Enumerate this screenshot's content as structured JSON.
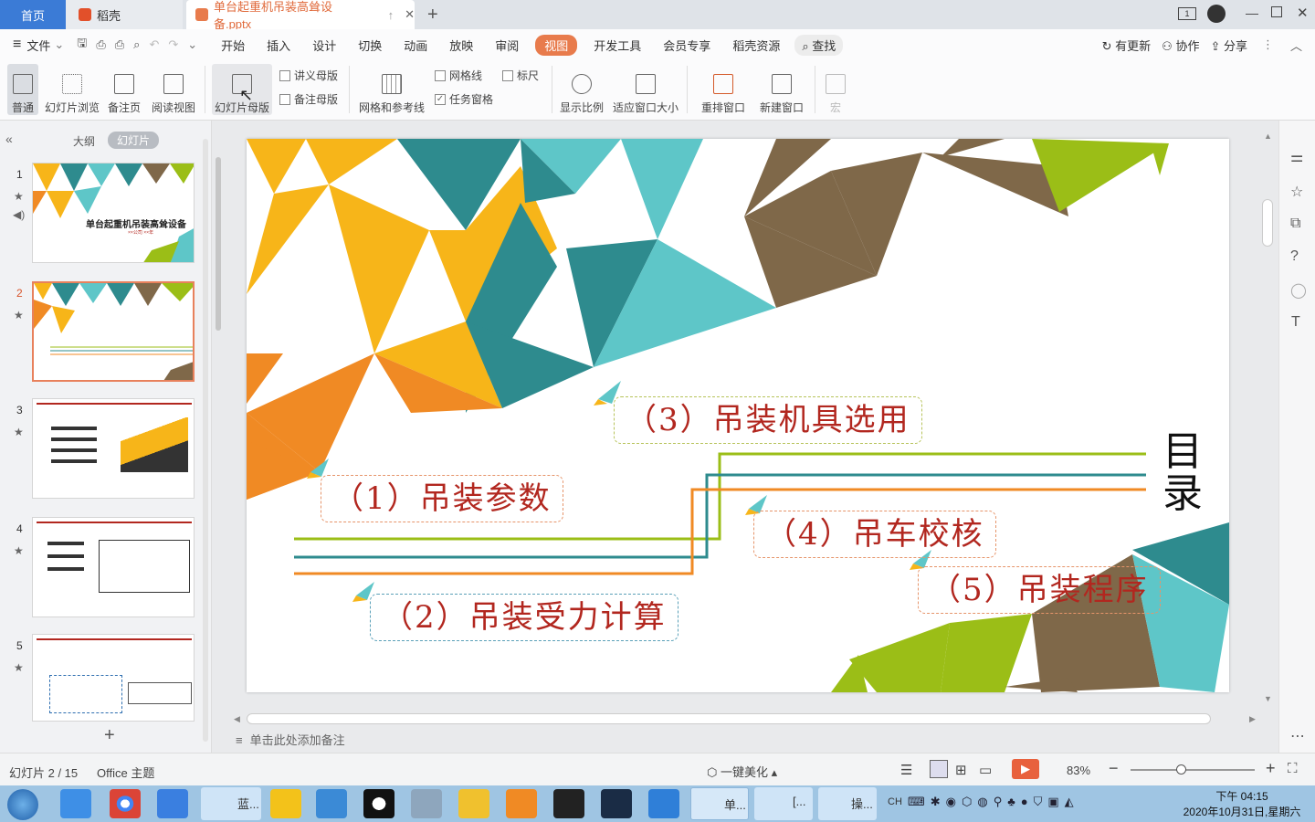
{
  "tabs": {
    "home": "首页",
    "daoke": "稻壳",
    "doc": "单台起重机吊装高耸设备.pptx"
  },
  "menu": {
    "file": "文件",
    "items": [
      "开始",
      "插入",
      "设计",
      "切换",
      "动画",
      "放映",
      "审阅",
      "视图",
      "开发工具",
      "会员专享",
      "稻壳资源"
    ],
    "search": "查找",
    "update": "有更新",
    "collab": "协作",
    "share": "分享"
  },
  "ribbon": {
    "normal": "普通",
    "slide_browse": "幻灯片浏览",
    "notes_page": "备注页",
    "reading_view": "阅读视图",
    "slide_master": "幻灯片母版",
    "handout_master": "讲义母版",
    "notes_master": "备注母版",
    "grid_guides": "网格和参考线",
    "gridlines": "网格线",
    "ruler": "标尺",
    "task_pane": "任务窗格",
    "zoom": "显示比例",
    "fit_window": "适应窗口大小",
    "arrange": "重排窗口",
    "new_window": "新建窗口",
    "macro": "宏"
  },
  "panel": {
    "outline": "大纲",
    "slides": "幻灯片"
  },
  "thumb1": {
    "title": "单台起重机吊装高耸设备",
    "subtitle": "××公司 ××年"
  },
  "thumbs": [
    {
      "num": "1"
    },
    {
      "num": "2"
    },
    {
      "num": "3"
    },
    {
      "num": "4"
    },
    {
      "num": "5"
    }
  ],
  "slide": {
    "title": "目录",
    "items": [
      {
        "text": "（1）吊装参数",
        "color": "#e6946a"
      },
      {
        "text": "（2）吊装受力计算",
        "color": "#5aa0b8"
      },
      {
        "text": "（3）吊装机具选用",
        "color": "#b7c35a"
      },
      {
        "text": "（4）吊车校核",
        "color": "#e6946a"
      },
      {
        "text": "（5）吊装程序",
        "color": "#e6946a"
      }
    ],
    "colors": {
      "orange": "#f08a24",
      "yellow": "#f7b519",
      "teal": "#2e8b8e",
      "cyan": "#5ec6c8",
      "brown": "#7f6849",
      "green": "#9bbe17",
      "red": "#b2271f"
    }
  },
  "notes_placeholder": "单击此处添加备注",
  "status": {
    "slide_info": "幻灯片 2 / 15",
    "theme": "Office 主题",
    "beautify": "一键美化",
    "zoom": "83%"
  },
  "taskbar": {
    "time": "下午 04:15",
    "date": "2020年10月31日,星期六",
    "ime": "CH",
    "items": [
      "蓝...",
      "单...",
      "[...",
      "操..."
    ]
  }
}
